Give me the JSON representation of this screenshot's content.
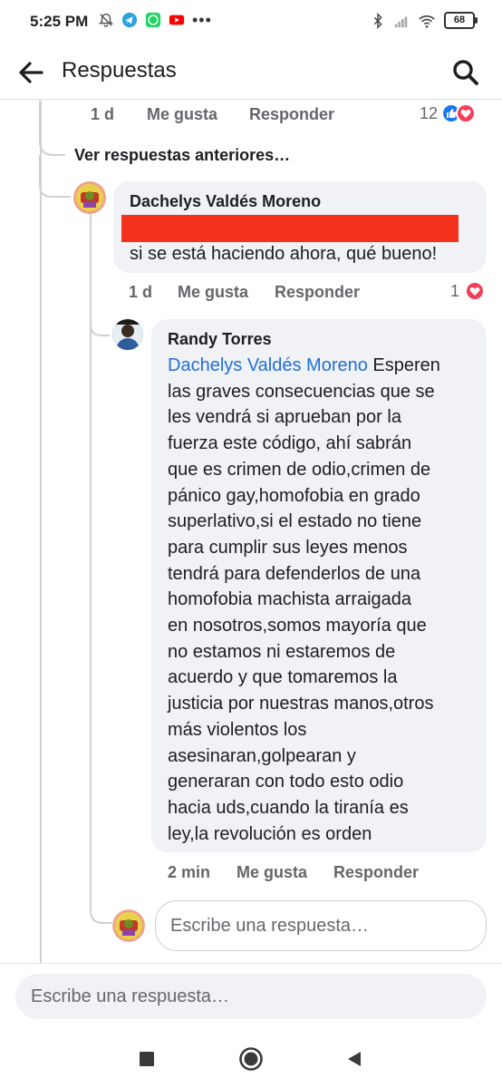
{
  "status_bar": {
    "time": "5:25 PM",
    "left_icons": [
      "bell-off-icon",
      "telegram-icon",
      "whatsapp-icon",
      "youtube-icon"
    ],
    "more": "•••",
    "right_icons": [
      "bluetooth-icon",
      "signal-icon",
      "wifi-icon"
    ],
    "battery": "68"
  },
  "header": {
    "title": "Respuestas",
    "back_icon": "back-arrow-icon",
    "search_icon": "search-icon"
  },
  "top_comment_meta": {
    "time": "1 d",
    "like": "Me gusta",
    "reply": "Responder",
    "reaction_count": "12",
    "reactions": [
      "like",
      "love"
    ]
  },
  "view_previous": "Ver respuestas anteriores…",
  "comment1": {
    "author": "Dachelys Valdés Moreno",
    "redacted_line": true,
    "text": "si se está haciendo ahora, qué bueno!",
    "time": "1 d",
    "like": "Me gusta",
    "reply": "Responder",
    "reaction_count": "1",
    "reactions": [
      "love"
    ]
  },
  "comment2": {
    "author": "Randy Torres",
    "mention": "Dachelys Valdés Moreno",
    "lines": [
      " Esperen",
      "las graves consecuencias que se",
      "les vendrá si aprueban por la",
      "fuerza este código, ahí sabrán",
      "que es crimen de odio,crimen de",
      "pánico gay,homofobia en grado",
      "superlativo,si el estado no tiene",
      "para cumplir sus leyes menos",
      "tendrá para defenderlos de una",
      "homofobia machista arraigada",
      "en nosotros,somos mayoría que",
      "no estamos ni estaremos de",
      "acuerdo y que tomaremos la",
      "justicia por nuestras manos,otros",
      "más violentos los",
      "asesinaran,golpearan y",
      "generaran con todo esto odio",
      "hacia uds,cuando la tiranía es",
      "ley,la revolución es orden"
    ],
    "time": "2 min",
    "like": "Me gusta",
    "reply": "Responder"
  },
  "reply_input": {
    "placeholder": "Escribe una respuesta…"
  },
  "bottom_input": {
    "placeholder": "Escribe una respuesta…"
  },
  "nav": [
    "recents-icon",
    "home-icon",
    "back-triangle-icon"
  ],
  "colors": {
    "mention": "#216fdb",
    "like_blue": "#1877f2",
    "love_red": "#f33e58",
    "redaction": "#f4311c",
    "bubble": "#f0f2f5"
  }
}
